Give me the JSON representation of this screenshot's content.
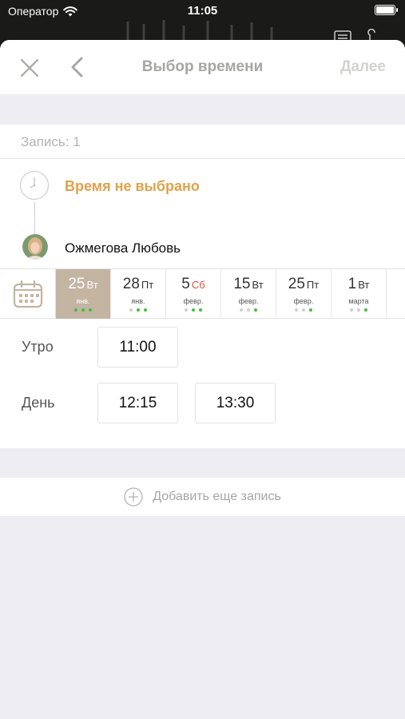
{
  "status": {
    "carrier": "Оператор",
    "time": "11:05"
  },
  "nav": {
    "title": "Выбор времени",
    "next": "Далее"
  },
  "record": {
    "header": "Запись: 1",
    "time_status": "Время не выбрано",
    "master_name": "Ожмегова Любовь"
  },
  "dates": [
    {
      "num": "25",
      "wd": "Вт",
      "mon": "янв.",
      "selected": true,
      "weekend": false,
      "dots": [
        1,
        1,
        1
      ]
    },
    {
      "num": "28",
      "wd": "Пт",
      "mon": "янв.",
      "selected": false,
      "weekend": false,
      "dots": [
        0,
        1,
        1
      ]
    },
    {
      "num": "5",
      "wd": "Сб",
      "mon": "февр.",
      "selected": false,
      "weekend": true,
      "dots": [
        0,
        1,
        1
      ]
    },
    {
      "num": "15",
      "wd": "Вт",
      "mon": "февр.",
      "selected": false,
      "weekend": false,
      "dots": [
        0,
        0,
        1
      ]
    },
    {
      "num": "25",
      "wd": "Пт",
      "mon": "февр.",
      "selected": false,
      "weekend": false,
      "dots": [
        0,
        0,
        1
      ]
    },
    {
      "num": "1",
      "wd": "Вт",
      "mon": "марта",
      "selected": false,
      "weekend": false,
      "dots": [
        0,
        0,
        1
      ]
    }
  ],
  "slots": {
    "morning_label": "Утро",
    "morning": [
      "11:00"
    ],
    "day_label": "День",
    "day": [
      "12:15",
      "13:30"
    ]
  },
  "add": {
    "label": "Добавить еще запись"
  },
  "colors": {
    "accent": "#e0a24a",
    "selected_day": "#c4b4a2",
    "available_dot": "#3fc23f",
    "weekend": "#d9503f"
  }
}
